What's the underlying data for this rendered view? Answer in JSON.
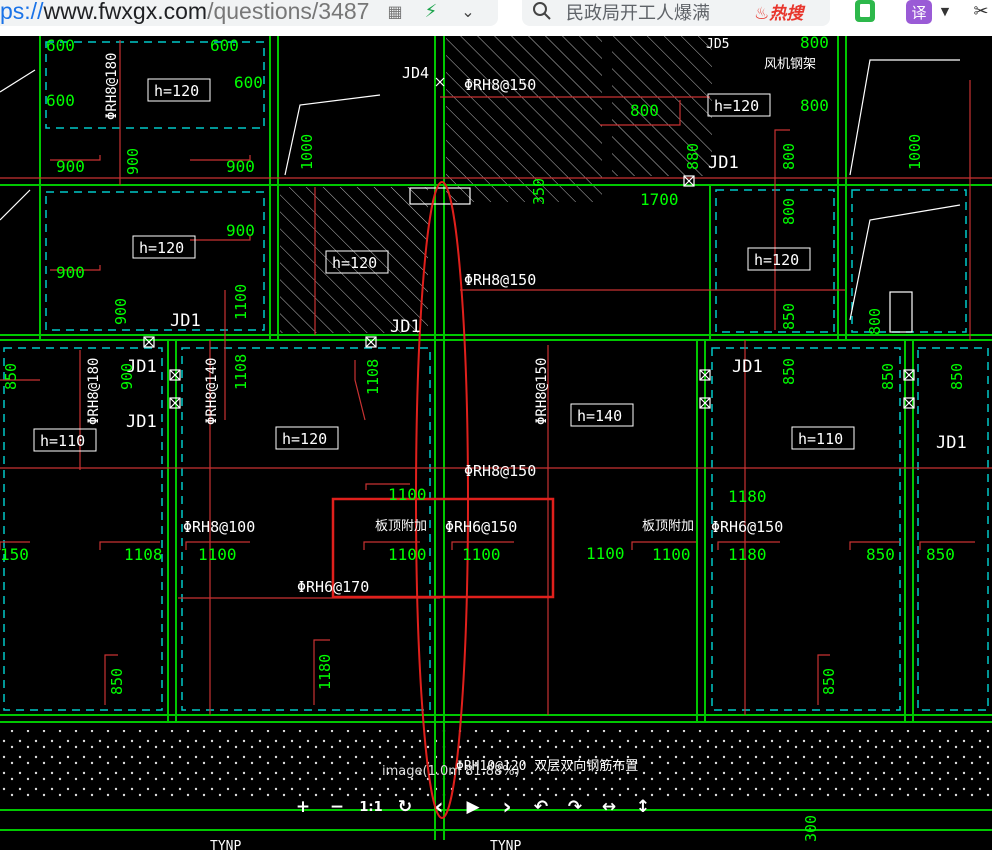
{
  "browser": {
    "url_prefix": "ps://",
    "url_main": "www.fwxgx.com",
    "url_path": "/questions/3487",
    "search_text": "民政局开工人爆满",
    "hot_label": "热搜",
    "translate_label": "译"
  },
  "cad": {
    "h_labels": [
      "h=120",
      "h=120",
      "h=120",
      "h=120",
      "h=120",
      "h=110",
      "h=120",
      "h=140",
      "h=110"
    ],
    "rebar_labels": [
      "ΦRH8@150",
      "ΦRH8@150",
      "ΦRH8@150",
      "ΦRH8@100",
      "ΦRH6@150",
      "ΦRH6@150",
      "ΦRH6@170",
      "ΦRH8@180",
      "ΦRH8@180",
      "ΦRH8@140",
      "ΦRH8@150"
    ],
    "jd_labels": [
      "JD4",
      "JD1",
      "JD1",
      "JD1",
      "JD1",
      "JD1",
      "JD1",
      "JD1",
      "JD5"
    ],
    "dims": {
      "d600a": "600",
      "d600b": "600",
      "d600c": "600",
      "d800a": "800",
      "d800b": "800",
      "d800c": "800",
      "d800d": "800",
      "d800e": "800",
      "d900a": "900",
      "d900b": "900",
      "d900c": "900",
      "d900d": "900",
      "d900e": "900",
      "d900f": "900",
      "d900g": "900",
      "d1000a": "1000",
      "d1000b": "1000",
      "d1100a": "1100",
      "d1100b": "1100",
      "d1100c": "1100",
      "d1100d": "1100",
      "d1100e": "1100",
      "d1100f": "1100",
      "d1100g": "1100",
      "d1180a": "1180",
      "d1180b": "1180",
      "d1180c": "1180",
      "d850a": "850",
      "d850b": "850",
      "d850c": "850",
      "d850d": "850",
      "d850e": "850",
      "d850f": "850",
      "d850g": "850",
      "d850h": "850",
      "d1700": "1700",
      "d350": "350",
      "d300": "300",
      "d880": "880",
      "d1108a": "1108",
      "d1108b": "1108",
      "d1108c": "1108",
      "d150": "150"
    },
    "notes": {
      "n1": "板顶附加",
      "n2": "板顶附加",
      "n3": "板顶附加",
      "n4": "风机钢架",
      "bottom": "ΦRH10@120 双层双向钢筋布置",
      "tkn1": "TYNP",
      "tkn2": "TYNP",
      "vert_a": "ΦRH8@180"
    }
  },
  "viewer": {
    "caption": "image(1.0m 81.88%)",
    "buttons": [
      {
        "name": "zoom-in-button",
        "label": "+"
      },
      {
        "name": "zoom-out-button",
        "label": "−"
      },
      {
        "name": "actual-size-button",
        "label": "1:1"
      },
      {
        "name": "reset-button",
        "label": "↻"
      },
      {
        "name": "prev-button",
        "label": "‹"
      },
      {
        "name": "play-button",
        "label": "▶"
      },
      {
        "name": "next-button",
        "label": "›"
      },
      {
        "name": "rotate-left-button",
        "label": "↶"
      },
      {
        "name": "rotate-right-button",
        "label": "↷"
      },
      {
        "name": "flip-horizontal-button",
        "label": "↔"
      },
      {
        "name": "flip-vertical-button",
        "label": "↕"
      }
    ]
  },
  "colors": {
    "background": "#000000",
    "wall_green": "#00c800",
    "text_green": "#00ff00",
    "dim_red": "#c83232",
    "dash_cyan": "#00c8c8",
    "highlight_red": "#e0201c"
  }
}
